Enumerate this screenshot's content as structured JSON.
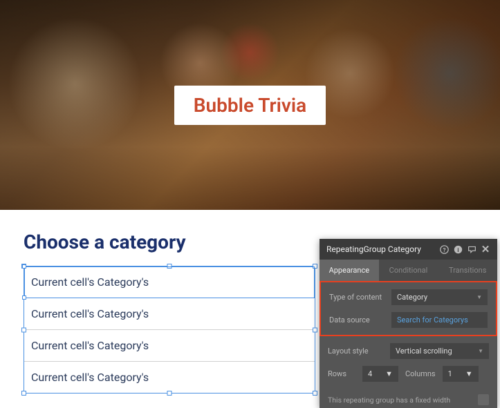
{
  "hero": {
    "title": "Bubble Trivia",
    "title_color": "#c94a2c"
  },
  "section": {
    "title": "Choose a category",
    "title_color": "#1a2f6b"
  },
  "repeating_group": {
    "cells": [
      "Current cell's Category's",
      "Current cell's Category's",
      "Current cell's Category's",
      "Current cell's Category's"
    ],
    "cell_text_color": "#2a3a5a"
  },
  "panel": {
    "title": "RepeatingGroup Category",
    "tabs": {
      "appearance": "Appearance",
      "conditional": "Conditional",
      "transitions": "Transitions"
    },
    "active_tab": "appearance",
    "props": {
      "type_of_content": {
        "label": "Type of content",
        "value": "Category"
      },
      "data_source": {
        "label": "Data source",
        "value": "Search for Categorys"
      },
      "layout_style": {
        "label": "Layout style",
        "value": "Vertical scrolling"
      },
      "rows": {
        "label": "Rows",
        "value": "4"
      },
      "columns": {
        "label": "Columns",
        "value": "1"
      },
      "fixed_width": {
        "label": "This repeating group has a fixed width",
        "checked": false
      }
    }
  }
}
